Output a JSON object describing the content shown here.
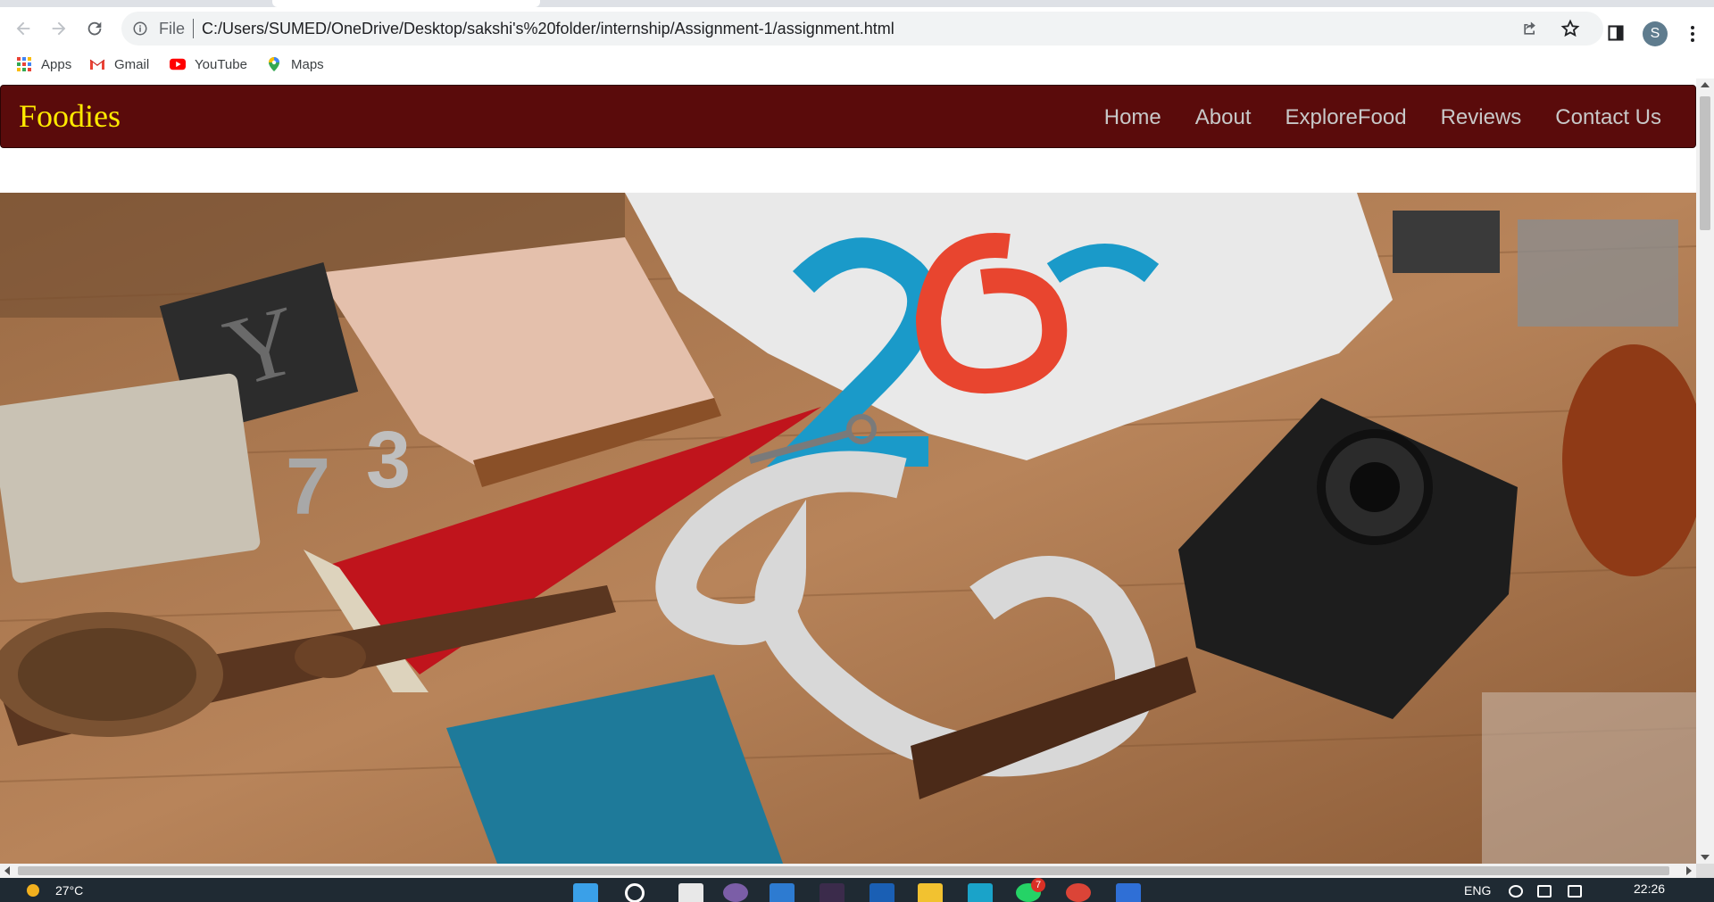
{
  "browser": {
    "address": {
      "scheme_label": "File",
      "url": "C:/Users/SUMED/OneDrive/Desktop/sakshi's%20folder/internship/Assignment-1/assignment.html"
    },
    "profile_initial": "S",
    "bookmarks": [
      {
        "label": "Apps",
        "icon": "apps-grid-icon"
      },
      {
        "label": "Gmail",
        "icon": "gmail-icon"
      },
      {
        "label": "YouTube",
        "icon": "youtube-icon"
      },
      {
        "label": "Maps",
        "icon": "maps-pin-icon"
      }
    ]
  },
  "page": {
    "brand": "Foodies",
    "nav": [
      {
        "label": "Home"
      },
      {
        "label": "About"
      },
      {
        "label": "ExploreFood"
      },
      {
        "label": "Reviews"
      },
      {
        "label": "Contact Us"
      }
    ],
    "hero_image": {
      "description_icon": "hero-photo"
    },
    "colors": {
      "navbar_bg": "#5a0b0b",
      "brand": "#ffea00",
      "nav_link": "#c8c8c8"
    }
  },
  "taskbar": {
    "temperature": "27°C",
    "language": "ENG",
    "time": "22:26",
    "badges": {
      "whatsapp": "7"
    }
  }
}
